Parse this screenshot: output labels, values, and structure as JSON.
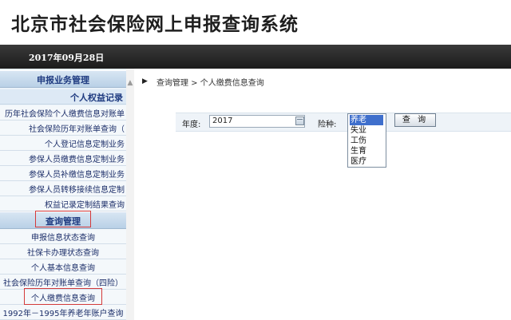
{
  "header": {
    "title": "北京市社会保险网上申报查询系统"
  },
  "datebar": {
    "date": "2017年09月28日"
  },
  "sidebar": {
    "section1_title": "申报业务管理",
    "sub1_title": "个人权益记录",
    "group1": [
      "历年社会保险个人缴费信息对账单",
      "社会保险历年对账单查询（",
      "个人登记信息定制业务",
      "参保人员缴费信息定制业务",
      "参保人员补缴信息定制业务",
      "参保人员转移接续信息定制",
      "权益记录定制结果查询"
    ],
    "section2_title": "查询管理",
    "group2": [
      "申报信息状态查询",
      "社保卡办理状态查询",
      "个人基本信息查询",
      "社会保险历年对账单查询（四险）",
      "个人缴费信息查询",
      "1992年－1995年养老年账户查询"
    ]
  },
  "main": {
    "breadcrumb": "查询管理 > 个人缴费信息查询",
    "year_label": "年度:",
    "year_value": "2017",
    "type_label": "险种:",
    "type_options": [
      "养老",
      "失业",
      "工伤",
      "生育",
      "医疗"
    ],
    "selected_type": "养老",
    "query_button": "查 询"
  },
  "colors": {
    "datebar": "#1c1c1c",
    "sidebar_bg": "#eaf2f9",
    "menu_text": "#1d2f6a",
    "highlight_box": "#d43a3a",
    "selected_option": "#3f6fcc"
  }
}
